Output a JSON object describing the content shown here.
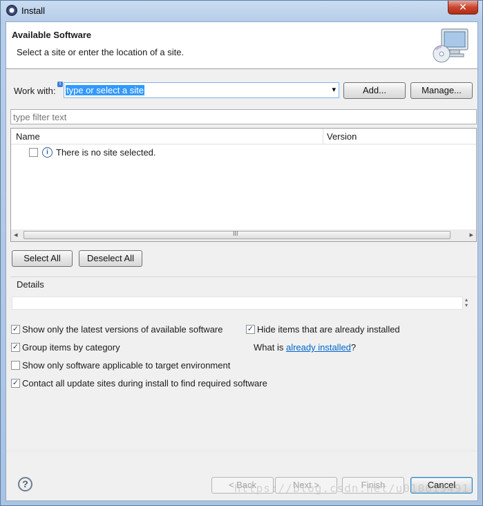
{
  "window": {
    "title": "Install",
    "close_glyph": "✕"
  },
  "header": {
    "title": "Available Software",
    "subtitle": "Select a site or enter the location of a site.",
    "icon": "cd-monitor-icon"
  },
  "work_with": {
    "label": "Work with:",
    "value": "type or select a site",
    "info_glyph": "i",
    "dropdown_glyph": "▾",
    "add_label": "Add...",
    "manage_label": "Manage..."
  },
  "filter": {
    "placeholder": "type filter text"
  },
  "table": {
    "columns": [
      "Name",
      "Version"
    ],
    "rows": [
      {
        "name": "There is no site selected.",
        "version": "",
        "checked": false,
        "icon": "info-icon"
      }
    ],
    "scroll_left": "◂",
    "scroll_right": "▸",
    "scroll_grip": "III"
  },
  "selection_buttons": {
    "select_all": "Select All",
    "deselect_all": "Deselect All"
  },
  "details": {
    "label": "Details",
    "text": ""
  },
  "options": {
    "latest_versions": {
      "label": "Show only the latest versions of available software",
      "checked": true
    },
    "hide_installed": {
      "label": "Hide items that are already installed",
      "checked": true
    },
    "group_by_category": {
      "label": "Group items by category",
      "checked": true
    },
    "target_env": {
      "label": "Show only software applicable to target environment",
      "checked": false
    },
    "contact_sites": {
      "label": "Contact all update sites during install to find required software",
      "checked": true
    },
    "what_is_prefix": "What is ",
    "what_is_link": "already installed",
    "what_is_suffix": "?"
  },
  "footer": {
    "help_glyph": "?",
    "back": "< Back",
    "next": "Next >",
    "finish": "Finish",
    "cancel": "Cancel"
  },
  "watermark": "https://blog.csdn.net/u010019491",
  "colors": {
    "title_bar": "#b7cde8",
    "link": "#0066cc",
    "selection": "#3399ff"
  }
}
